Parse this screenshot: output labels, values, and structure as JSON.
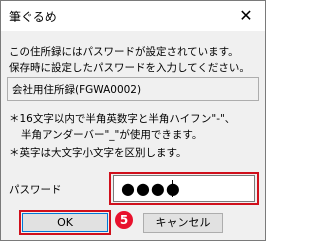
{
  "window": {
    "title": "筆ぐるめ",
    "close_glyph": "✕"
  },
  "message": {
    "line1": "この住所録にはパスワードが設定されています。",
    "line2": "保存時に設定したパスワードを入力してください。"
  },
  "address_book_name": "会社用住所録(FGWA0002)",
  "notes": {
    "note1_line1": "＊16文字以内で半角英数字と半角ハイフン\"-\"、",
    "note1_line2": "半角アンダーバー\"_\"が使用できます。",
    "note2": "＊英字は大文字小文字を区別します。"
  },
  "password": {
    "label": "パスワード",
    "masked_value": "●●●●"
  },
  "buttons": {
    "ok": "OK",
    "cancel": "キャンセル"
  },
  "step_badge": "5",
  "colors": {
    "highlight": "#d0101c",
    "badge": "#e8112d",
    "focus_border": "#0078d7"
  }
}
